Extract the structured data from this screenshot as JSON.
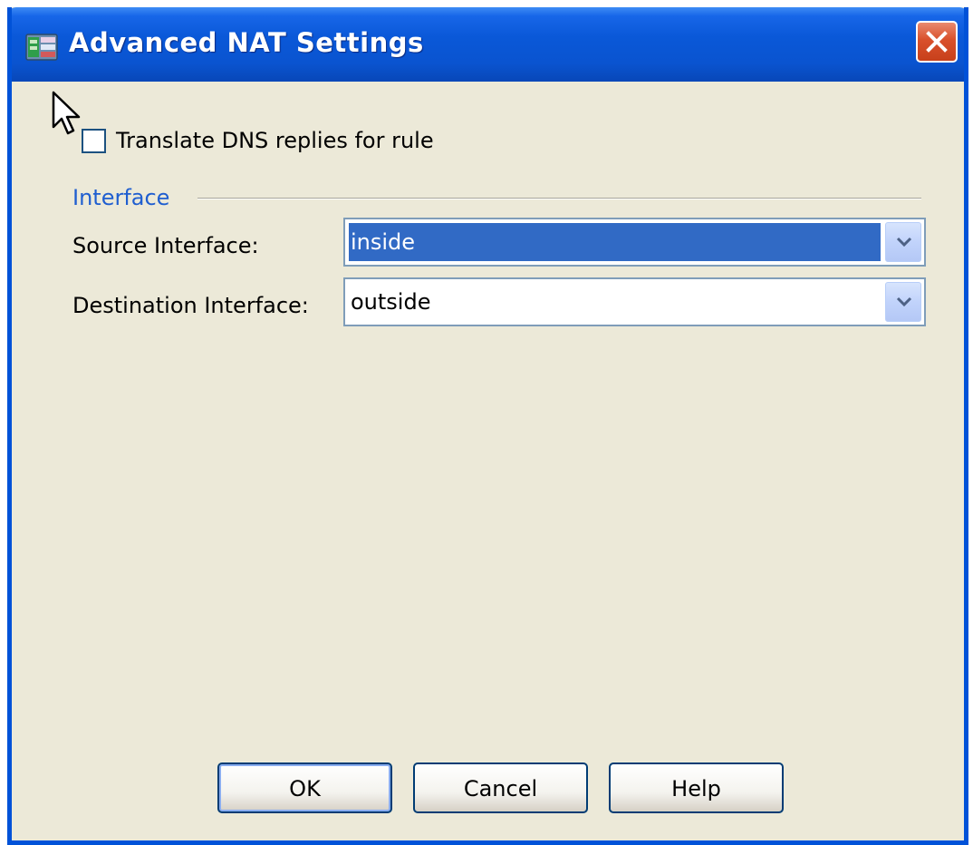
{
  "window": {
    "title": "Advanced NAT Settings"
  },
  "options": {
    "translate_dns_label": "Translate DNS replies for rule",
    "translate_dns_checked": false
  },
  "interface_group": {
    "title": "Interface",
    "source_label": "Source Interface:",
    "source_value": "inside",
    "destination_label": "Destination Interface:",
    "destination_value": "outside"
  },
  "buttons": {
    "ok": "OK",
    "cancel": "Cancel",
    "help": "Help"
  },
  "icons": {
    "app": "asdm-window-icon",
    "close": "close-icon",
    "dropdown": "chevron-down-icon",
    "cursor": "mouse-pointer-icon"
  },
  "colors": {
    "titlebar": "#0a58d8",
    "dialog_bg": "#ece9d8",
    "group_title": "#1f5ed0",
    "selection": "#316ac5",
    "close_button": "#d9502b"
  }
}
